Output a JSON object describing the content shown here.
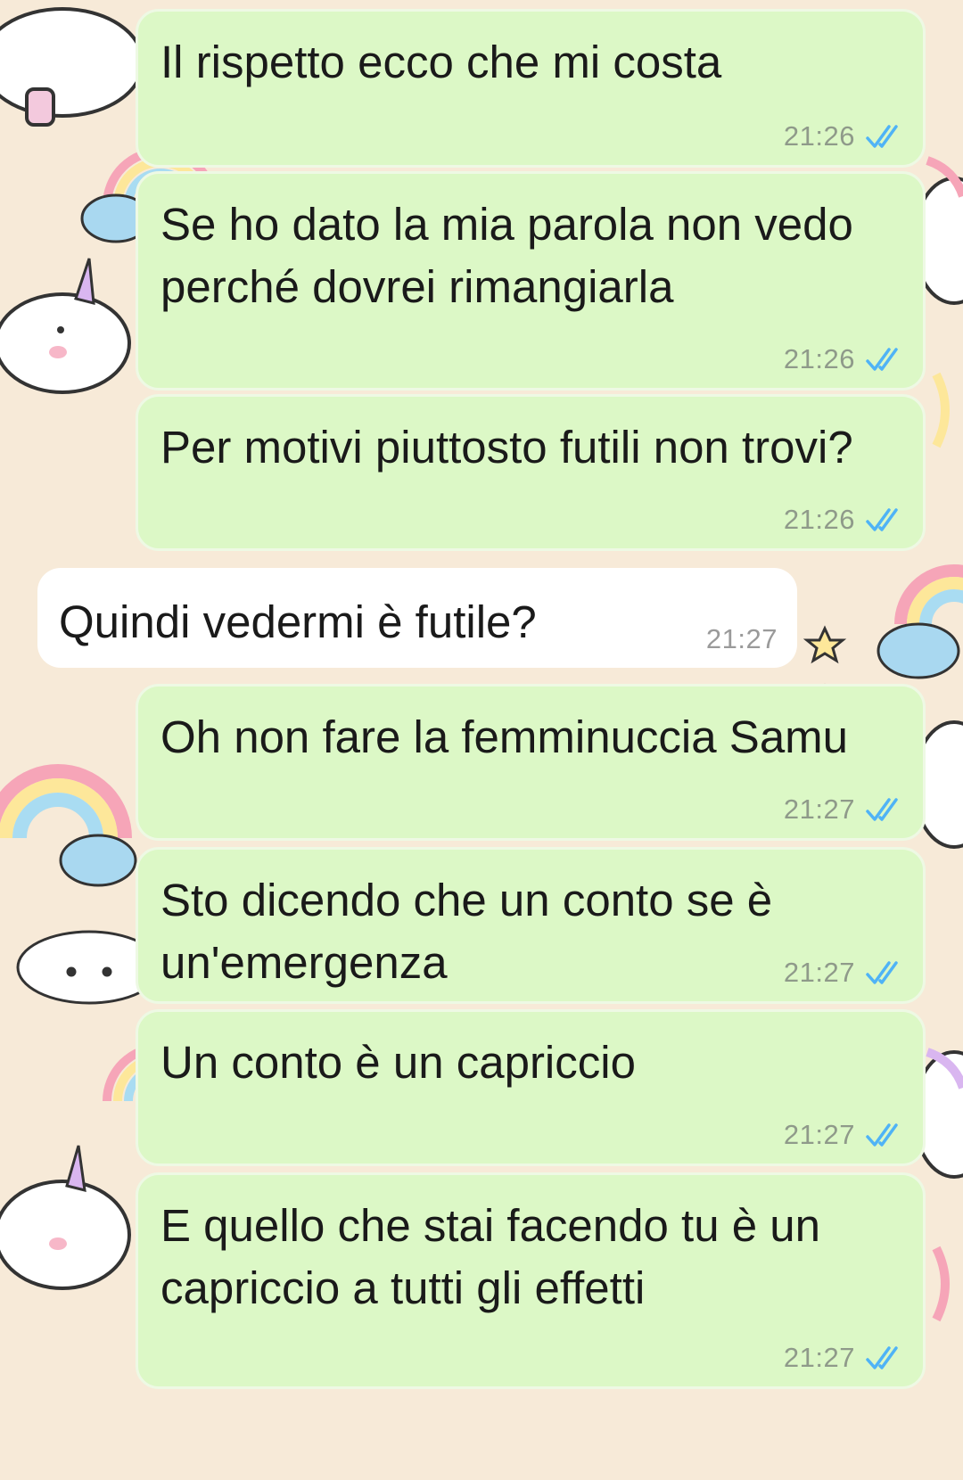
{
  "colors": {
    "outgoing_bubble": "#dcf8c6",
    "incoming_bubble": "#ffffff",
    "read_ticks": "#4fb3f6",
    "timestamp": "#8f9a8a",
    "wallpaper": "#f7ead8"
  },
  "icons": {
    "read_receipt": "double-check-icon"
  },
  "messages": [
    {
      "direction": "out",
      "text": "Il rispetto ecco che mi costa",
      "time": "21:26",
      "status": "read"
    },
    {
      "direction": "out",
      "text": "Se ho dato la mia parola non vedo perché dovrei rimangiarla",
      "time": "21:26",
      "status": "read"
    },
    {
      "direction": "out",
      "text": "Per motivi piuttosto futili non trovi?",
      "time": "21:26",
      "status": "read"
    },
    {
      "direction": "in",
      "text": "Quindi vedermi è futile?",
      "time": "21:27"
    },
    {
      "direction": "out",
      "text": "Oh non fare la femminuccia Samu",
      "time": "21:27",
      "status": "read"
    },
    {
      "direction": "out",
      "text": "Sto dicendo che un conto se è un'emergenza",
      "time": "21:27",
      "status": "read"
    },
    {
      "direction": "out",
      "text": "Un conto è un capriccio",
      "time": "21:27",
      "status": "read"
    },
    {
      "direction": "out",
      "text": "E quello che stai facendo tu è un capriccio a tutti gli effetti",
      "time": "21:27",
      "status": "read"
    }
  ]
}
